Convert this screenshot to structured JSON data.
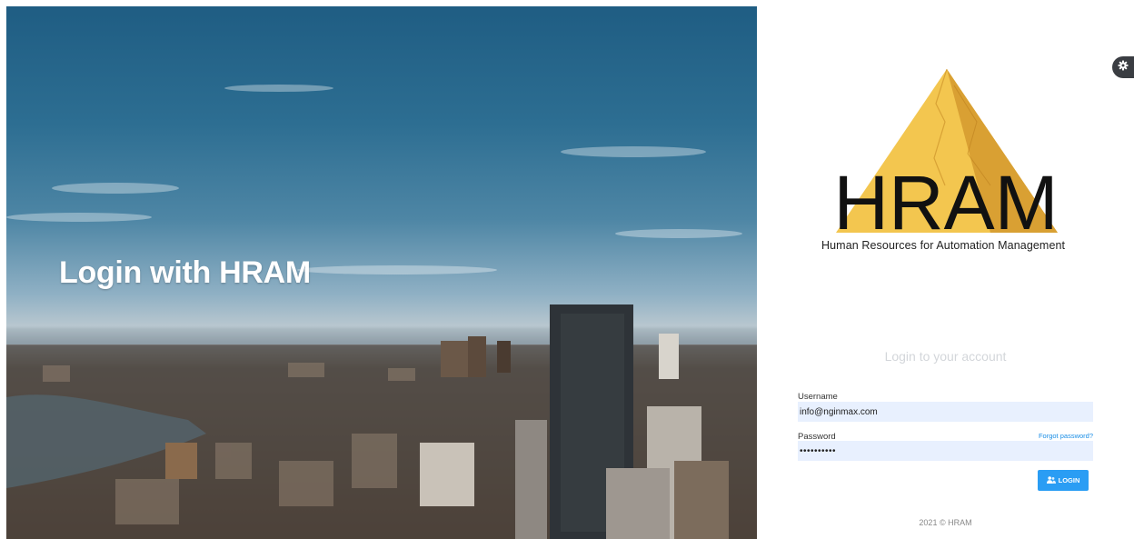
{
  "hero": {
    "title": "Login with HRAM"
  },
  "brand": {
    "logo_word": "HRAM",
    "tagline": "Human Resources for Automation Management"
  },
  "login": {
    "subtitle": "Login to your account",
    "username_label": "Username",
    "username_value": "info@nginmax.com",
    "password_label": "Password",
    "password_value": "••••••••••",
    "forgot_label": "Forgot password?",
    "submit_label": "LOGIN"
  },
  "footer": {
    "text": "2021 © HRAM"
  },
  "icons": {
    "settings": "gear-icon",
    "login_button": "users-icon"
  },
  "colors": {
    "accent": "#2a9df4",
    "input_bg": "#e8f0fe",
    "link": "#1a8ee6",
    "settings_tab": "#3a3d42",
    "logo_gold": "#f2c14e"
  }
}
